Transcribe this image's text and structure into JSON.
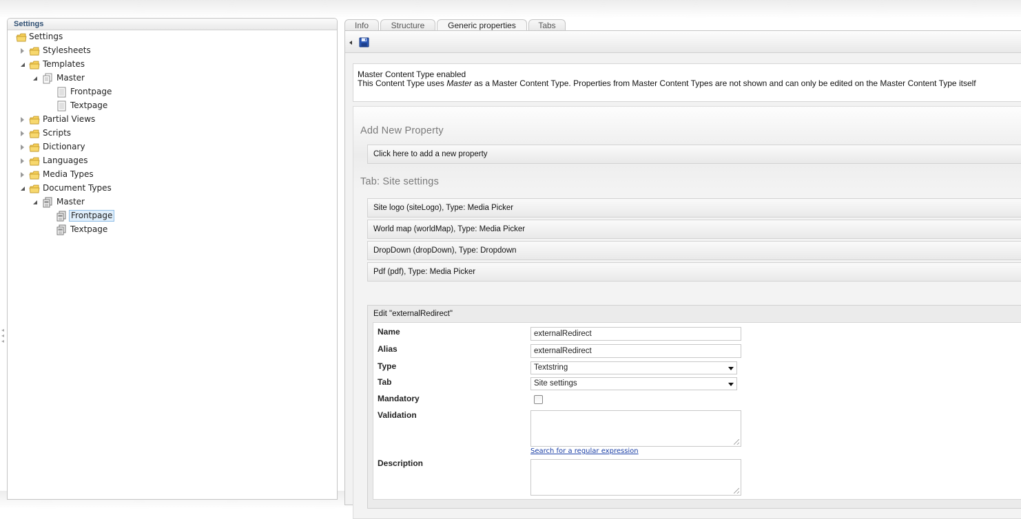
{
  "tree": {
    "header": "Settings",
    "items": [
      {
        "label": "Settings"
      },
      {
        "label": "Stylesheets"
      },
      {
        "label": "Templates"
      },
      {
        "label": "Master"
      },
      {
        "label": "Frontpage"
      },
      {
        "label": "Textpage"
      },
      {
        "label": "Partial Views"
      },
      {
        "label": "Scripts"
      },
      {
        "label": "Dictionary"
      },
      {
        "label": "Languages"
      },
      {
        "label": "Media Types"
      },
      {
        "label": "Document Types"
      },
      {
        "label": "Master"
      },
      {
        "label": "Frontpage",
        "selected": true
      },
      {
        "label": "Textpage"
      }
    ]
  },
  "tabs": [
    {
      "label": "Info"
    },
    {
      "label": "Structure"
    },
    {
      "label": "Generic properties",
      "active": true
    },
    {
      "label": "Tabs"
    }
  ],
  "info": {
    "title": "Master Content Type enabled",
    "text_before": "This Content Type uses ",
    "text_em": "Master",
    "text_after": " as a Master Content Type. Properties from Master Content Types are not shown and can only be edited on the Master Content Type itself"
  },
  "add_section": {
    "heading": "Add New Property",
    "bar": "Click here to add a new property"
  },
  "tab_section": {
    "heading": "Tab: Site settings",
    "properties": [
      "Site logo (siteLogo), Type: Media Picker",
      "World map (worldMap), Type: Media Picker",
      "DropDown (dropDown), Type: Dropdown",
      "Pdf (pdf), Type: Media Picker"
    ]
  },
  "edit": {
    "title": "Edit \"externalRedirect\"",
    "labels": {
      "name": "Name",
      "alias": "Alias",
      "type": "Type",
      "tab": "Tab",
      "mandatory": "Mandatory",
      "validation": "Validation",
      "description": "Description"
    },
    "values": {
      "name": "externalRedirect",
      "alias": "externalRedirect",
      "type": "Textstring",
      "tab": "Site settings",
      "mandatory": false,
      "validation": "",
      "description": ""
    },
    "regex_link": "Search for a regular expression"
  },
  "colors": {
    "tree_header": "#2f4f73",
    "selection_bg": "#dfeefb",
    "link": "#1a3fa6",
    "heading": "#7a7a7a"
  }
}
